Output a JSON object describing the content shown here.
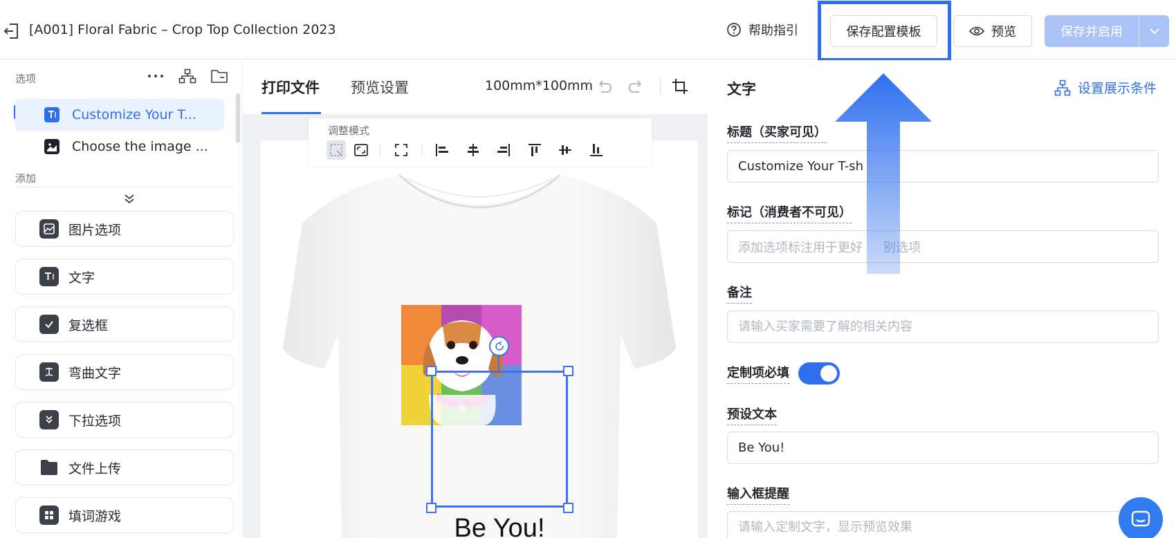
{
  "header": {
    "title": "[A001] Floral Fabric – Crop Top Collection 2023",
    "help_label": "帮助指引",
    "save_template_label": "保存配置模板",
    "preview_label": "预览",
    "save_enable_label": "保存并启用"
  },
  "sidebar": {
    "options_label": "选项",
    "options": [
      {
        "label": "Customize Your T...",
        "icon": "text-icon",
        "active": true
      },
      {
        "label": "Choose the image ...",
        "icon": "image-icon",
        "active": false
      }
    ],
    "add_label": "添加",
    "add_items": [
      {
        "label": "图片选项",
        "icon": "image-option-icon"
      },
      {
        "label": "文字",
        "icon": "text-icon"
      },
      {
        "label": "复选框",
        "icon": "checkbox-icon"
      },
      {
        "label": "弯曲文字",
        "icon": "curved-text-icon"
      },
      {
        "label": "下拉选项",
        "icon": "dropdown-icon"
      },
      {
        "label": "文件上传",
        "icon": "folder-icon"
      },
      {
        "label": "填词游戏",
        "icon": "word-game-icon"
      }
    ]
  },
  "canvas": {
    "tabs": [
      {
        "label": "打印文件",
        "active": true
      },
      {
        "label": "预览设置",
        "active": false
      }
    ],
    "size_label": "100mm*100mm",
    "mode_title": "调整模式",
    "print_text": "Be You!"
  },
  "panel": {
    "title": "文字",
    "condition_label": "设置展示条件",
    "title_field_label": "标题（买家可见）",
    "title_field_value": "Customize Your T-sh",
    "mark_field_label": "标记（消费者不可见）",
    "mark_field_placeholder": "添加选项标注用于更好",
    "mark_field_placeholder_suffix": "别选项",
    "note_field_label": "备注",
    "note_field_placeholder": "请输入买家需要了解的相关内容",
    "required_label": "定制项必填",
    "required_on": true,
    "preset_label": "预设文本",
    "preset_value": "Be You!",
    "hint_label": "输入框提醒",
    "hint_placeholder": "请输入定制文字，显示预览效果"
  },
  "colors": {
    "accent": "#2f6fee",
    "highlight_border": "#2f6fee",
    "primary_disabled": "#a9c3f7"
  }
}
